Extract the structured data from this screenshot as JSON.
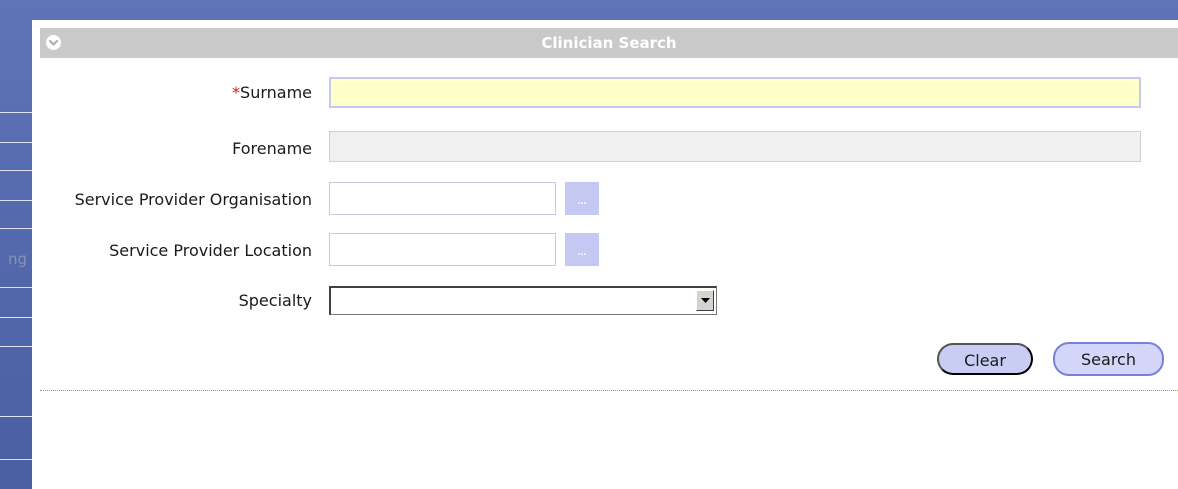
{
  "background": {
    "partial_text": "ng"
  },
  "dialog": {
    "title": "Clinician Search",
    "collapse_icon": "chevron-down-circle-icon"
  },
  "form": {
    "surname": {
      "required_mark": "*",
      "label": "Surname",
      "value": ""
    },
    "forename": {
      "label": "Forename",
      "value": ""
    },
    "service_provider_organisation": {
      "label": "Service Provider Organisation",
      "value": "",
      "lookup_label": "..."
    },
    "service_provider_location": {
      "label": "Service Provider Location",
      "value": "",
      "lookup_label": "..."
    },
    "specialty": {
      "label": "Specialty",
      "selected": ""
    }
  },
  "actions": {
    "clear_label": "Clear",
    "search_label": "Search"
  },
  "colors": {
    "background": "#5468ad",
    "titlebar": "#c9c9c9",
    "active_field": "#ffffc8",
    "button_fill": "#c9ccf3",
    "required": "#d21e1e"
  }
}
